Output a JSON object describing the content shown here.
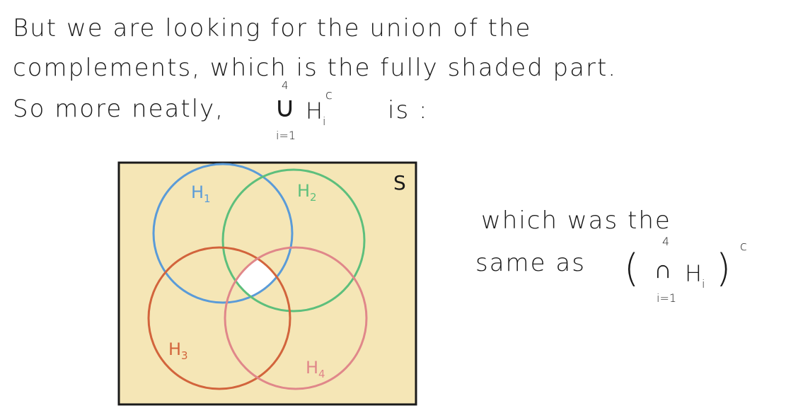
{
  "text": {
    "line1": "But we are looking for the union of the",
    "line2": "complements, which is the fully shaded part.",
    "line3_prefix": "So more neatly,",
    "line3_suffix": "is :",
    "side_line1": "which was the",
    "side_line2": "same as"
  },
  "math": {
    "union_expr": {
      "operator": "∪",
      "upper": "4",
      "lower": "i=1",
      "body": "H",
      "sub": "i",
      "sup": "c"
    },
    "intersection_expr": {
      "open_paren": "(",
      "operator": "∩",
      "upper": "4",
      "lower": "i=1",
      "body": "H",
      "sub": "i",
      "close_paren": ")",
      "sup": "c"
    }
  },
  "diagram": {
    "universe_label": "S",
    "sets": [
      {
        "label": "H",
        "sub": "1",
        "color": "#5a9bd8"
      },
      {
        "label": "H",
        "sub": "2",
        "color": "#5dbf7c"
      },
      {
        "label": "H",
        "sub": "3",
        "color": "#d2643c"
      },
      {
        "label": "H",
        "sub": "4",
        "color": "#e0878a"
      }
    ],
    "shade_color": "#f5e6b6",
    "border_color": "#1a1a1a"
  }
}
